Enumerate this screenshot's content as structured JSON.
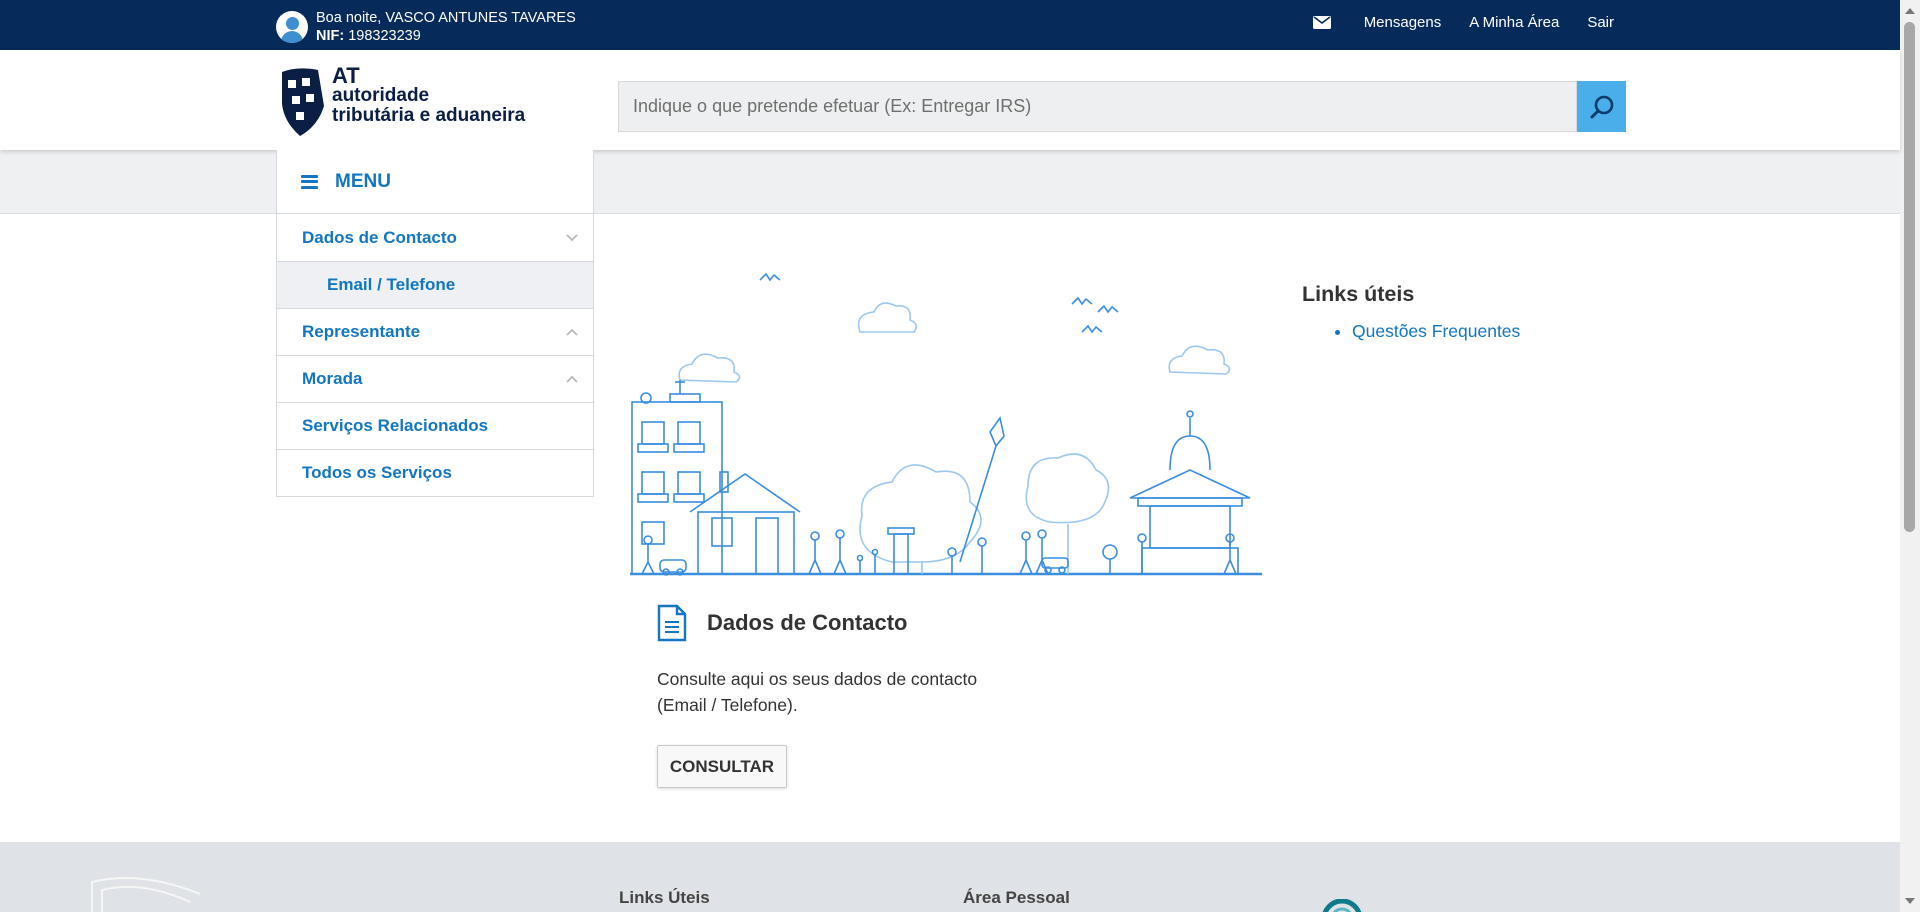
{
  "topbar": {
    "greeting": "Boa noite, VASCO ANTUNES TAVARES",
    "nif_label": "NIF:",
    "nif_value": "198323239",
    "links": {
      "messages": "Mensagens",
      "my_area": "A Minha Área",
      "logout": "Sair"
    }
  },
  "logo": {
    "line1": "AT",
    "line2": "autoridade",
    "line3": "tributária e aduaneira"
  },
  "search": {
    "placeholder": "Indique o que pretende efetuar (Ex: Entregar IRS)"
  },
  "menu": {
    "label": "MENU"
  },
  "sidebar": {
    "items": [
      {
        "label": "Dados de Contacto",
        "chevron": "down"
      },
      {
        "label": "Email / Telefone"
      },
      {
        "label": "Representante",
        "chevron": "up"
      },
      {
        "label": "Morada",
        "chevron": "up"
      },
      {
        "label": "Serviços Relacionados"
      },
      {
        "label": "Todos os Serviços"
      }
    ]
  },
  "card": {
    "title": "Dados de Contacto",
    "description": "Consulte aqui os seus dados de contacto (Email / Telefone).",
    "button": "CONSULTAR"
  },
  "links": {
    "title": "Links úteis",
    "items": [
      "Questões Frequentes"
    ]
  },
  "footer": {
    "col1": "Links Úteis",
    "col2": "Área Pessoal"
  },
  "colors": {
    "topbar": "#062a5a",
    "link": "#1376c0",
    "search_button": "#4aaeeb",
    "illustration": "#3a8ee0"
  }
}
